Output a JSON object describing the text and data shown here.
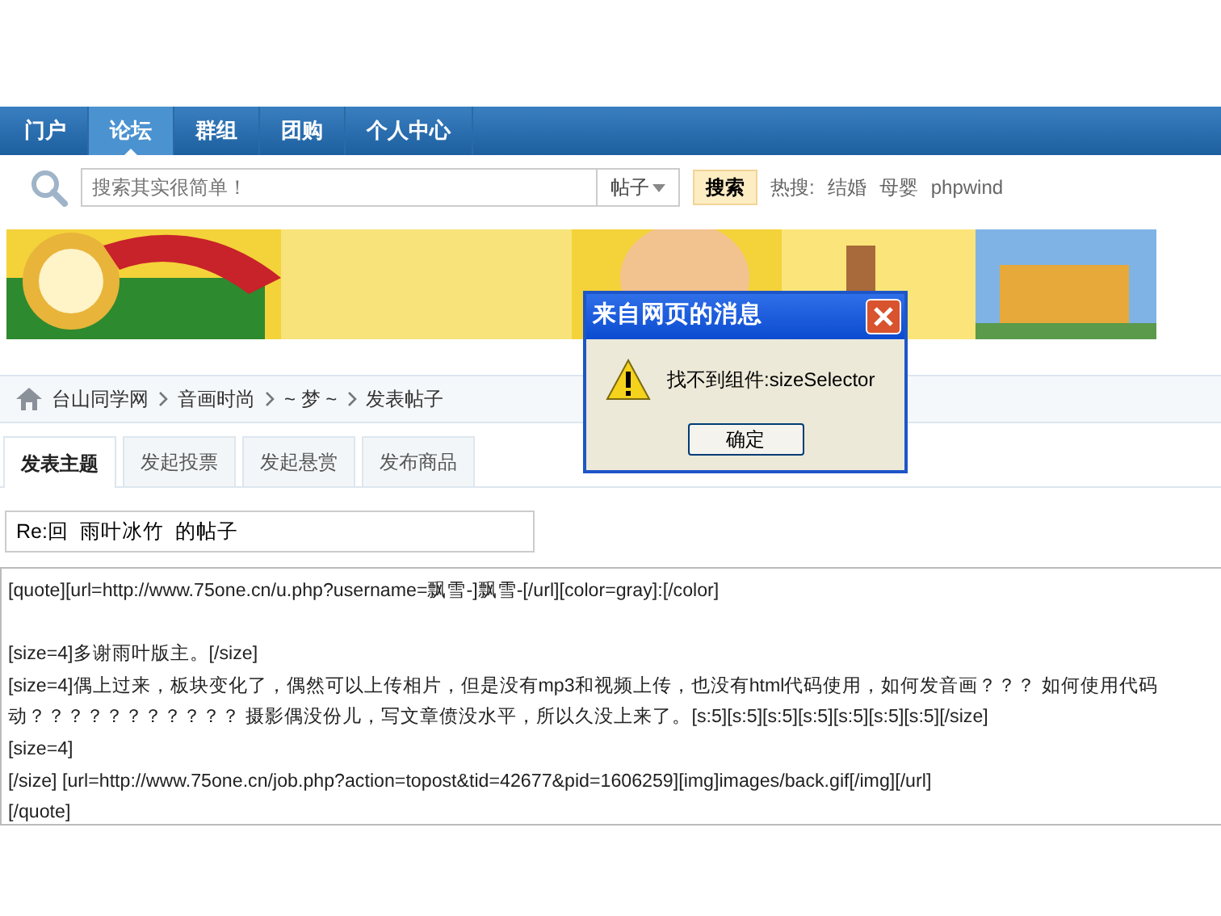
{
  "nav": {
    "items": [
      {
        "label": "门户",
        "selected": false
      },
      {
        "label": "论坛",
        "selected": true
      },
      {
        "label": "群组",
        "selected": false
      },
      {
        "label": "团购",
        "selected": false
      },
      {
        "label": "个人中心",
        "selected": false
      }
    ]
  },
  "search": {
    "placeholder": "搜索其实很简单！",
    "scope": "帖子",
    "button": "搜索",
    "hot_label": "热搜:",
    "hot_terms": [
      "结婚",
      "母婴",
      "phpwind"
    ]
  },
  "breadcrumb": [
    "台山同学网",
    "音画时尚",
    "~ 梦 ~",
    "发表帖子"
  ],
  "post_tabs": [
    {
      "label": "发表主题",
      "selected": true
    },
    {
      "label": "发起投票",
      "selected": false
    },
    {
      "label": "发起悬赏",
      "selected": false
    },
    {
      "label": "发布商品",
      "selected": false
    }
  ],
  "subject": {
    "value": "Re:回  雨叶冰竹  的帖子"
  },
  "editor_lines": [
    {
      "text": "[quote][url=http://www.75one.cn/u.php?username=飘雪-]飘雪-[/url][color=gray]:[/color]",
      "blank_before": false
    },
    {
      "text": "[size=4]多谢雨叶版主。[/size]",
      "blank_before": true
    },
    {
      "text": "[size=4]偶上过来，板块变化了，偶然可以上传相片，但是没有mp3和视频上传，也没有html代码使用，如何发音画？？？ 如何使用代码",
      "blank_before": false
    },
    {
      "text": "动？？？？？？？？？？？ 摄影偶没份儿，写文章偾没水平，所以久没上来了。[s:5][s:5][s:5][s:5][s:5][s:5][s:5][/size]",
      "blank_before": false
    },
    {
      "text": "[size=4]",
      "blank_before": false
    },
    {
      "text": "[/size] [url=http://www.75one.cn/job.php?action=topost&tid=42677&pid=1606259][img]images/back.gif[/img][/url]",
      "blank_before": false
    },
    {
      "text": "[/quote]",
      "blank_before": false
    }
  ],
  "dialog": {
    "title": "来自网页的消息",
    "message": "找不到组件:sizeSelector",
    "button": "确定"
  }
}
